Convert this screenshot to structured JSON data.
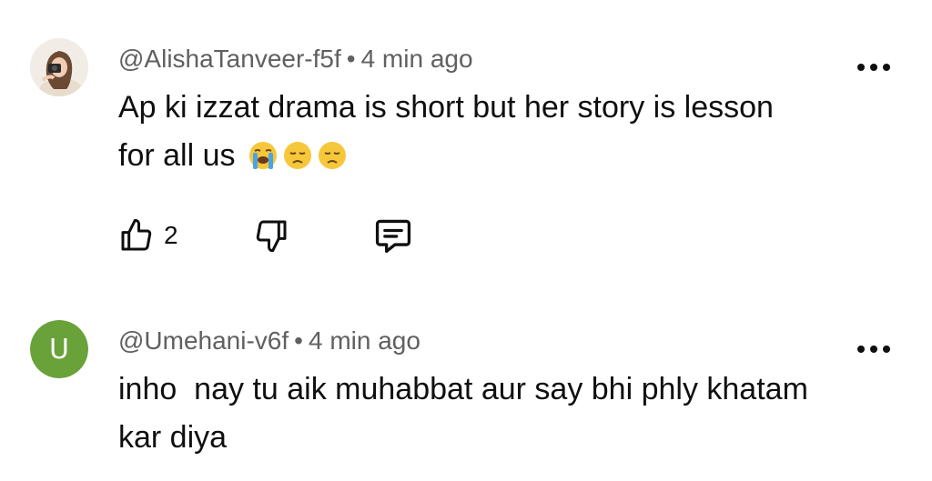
{
  "comments": [
    {
      "handle": "@AlishaTanveer-f5f",
      "separator": "•",
      "time": "4 min ago",
      "text_line1": "Ap ki izzat drama is short but her story is lesson",
      "text_line2": "for all us",
      "emojis": [
        "loudly-crying-face",
        "disappointed-face",
        "disappointed-face"
      ],
      "like_count": "2",
      "avatar": "photo"
    },
    {
      "handle": "@Umehani-v6f",
      "separator": "•",
      "time": "4 min ago",
      "text_line1": "inho  nay tu aik muhabbat aur say bhi phly khatam",
      "text_line2": "kar diya",
      "avatar_letter": "U",
      "avatar_color": "#6aa23a"
    }
  ],
  "colors": {
    "meta_text": "#606060",
    "body_text": "#0f0f0f"
  }
}
